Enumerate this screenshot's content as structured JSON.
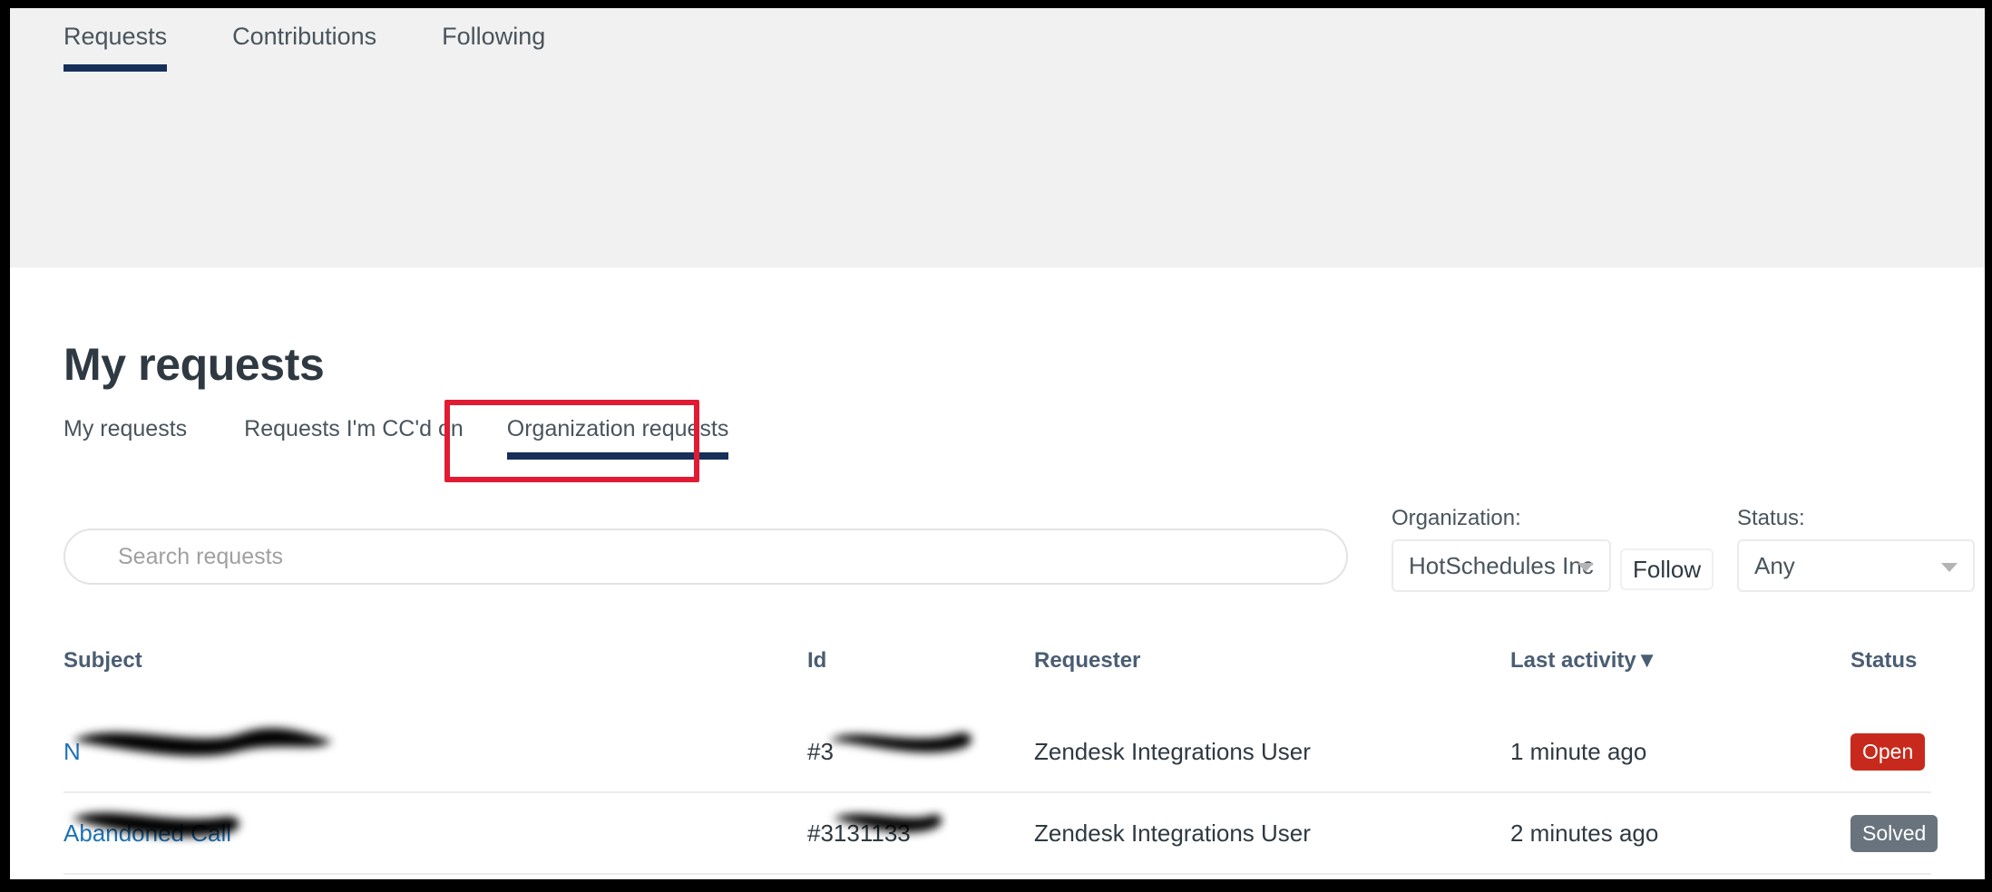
{
  "top_nav": {
    "tabs": [
      {
        "label": "Requests",
        "active": true
      },
      {
        "label": "Contributions",
        "active": false
      },
      {
        "label": "Following",
        "active": false
      }
    ]
  },
  "page": {
    "title": "My requests"
  },
  "sub_tabs": [
    {
      "label": "My requests",
      "active": false
    },
    {
      "label": "Requests I'm CC'd on",
      "active": false
    },
    {
      "label": "Organization requests",
      "active": true,
      "highlighted": true
    }
  ],
  "filters": {
    "search": {
      "placeholder": "Search requests",
      "value": ""
    },
    "organization": {
      "label": "Organization:",
      "selected": "HotSchedules Inc",
      "follow_label": "Follow"
    },
    "status": {
      "label": "Status:",
      "selected": "Any"
    }
  },
  "table": {
    "headers": {
      "subject": "Subject",
      "id": "Id",
      "requester": "Requester",
      "last_activity": "Last activity",
      "sort_indicator": "▼",
      "status": "Status"
    },
    "rows": [
      {
        "subject": "N",
        "id": "#3",
        "requester": "Zendesk Integrations User",
        "last_activity": "1 minute ago",
        "status": "Open",
        "status_kind": "open",
        "redacted": true
      },
      {
        "subject": "Abandoned Call",
        "id": "#3131133",
        "requester": "Zendesk Integrations User",
        "last_activity": "2 minutes ago",
        "status": "Solved",
        "status_kind": "solved",
        "redacted": true
      }
    ]
  },
  "colors": {
    "accent_navy": "#17305a",
    "link_blue": "#1f73b7",
    "annotation_red": "#e01b33",
    "status_open": "#c72a1c",
    "status_solved": "#68737d",
    "band_gray": "#f1f1f1"
  }
}
